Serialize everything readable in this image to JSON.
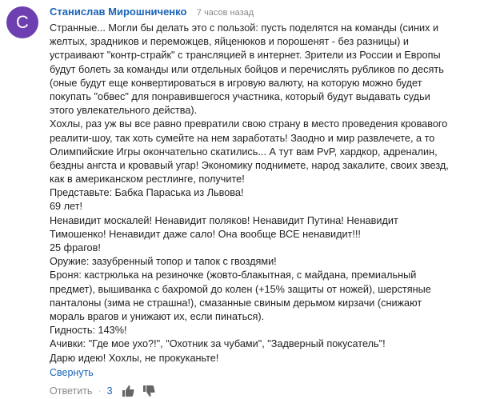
{
  "comment": {
    "avatar_letter": "C",
    "avatar_color": "#6d3fb0",
    "author": "Станислав Мирошниченко",
    "time": "7 часов назад",
    "lines": [
      "Странные... Могли бы делать это с пользой: пусть поделятся на команды (синих и",
      "желтых, зрадников и переможцев, яйценюков и порошенят - без разницы) и",
      "устраивают \"контр-страйк\" с трансляцией в интернет. Зрители из России и Европы",
      "будут болеть за команды или отдельных бойцов и перечислять рубликов по десять",
      "(оные будут еще конвертироваться в игровую валюту, на которую можно будет",
      "покупать \"обвес\" для понравившегося участника, который будут выдавать судьи",
      "этого увлекательного действа).",
      "Хохлы, раз уж вы все равно превратили свою страну в место проведения кровавого",
      "реалити-шоу, так хоть сумейте на нем заработать! Заодно и мир развлечете, а то",
      "Олимпийские Игры окончательно скатились... А тут вам PvP, хардкор, адреналин,",
      "бездны ангста и кровавый угар! Экономику поднимете, народ закалите, своих звезд,",
      "как в американском рестлинге, получите!",
      "Представьте: Бабка Параська из Львова!",
      "69 лет!",
      "Ненавидит москалей! Ненавидит поляков! Ненавидит Путина! Ненавидит",
      "Тимошенко! Ненавидит даже сало! Она вообще ВСЕ ненавидит!!!",
      "25 фрагов!",
      "Оружие: зазубренный топор и тапок с гвоздями!",
      "Броня: кастрюлька на резиночке (жовто-блакытная, с майдана, премиальный",
      "предмет), вышиванка с бахромой до колен (+15% защиты от ножей), шерстяные",
      "панталоны (зима не страшна!), смазанные свиным дерьмом кирзачи (снижают",
      "мораль врагов и унижают их, если пинаться).",
      "Гидность: 143%!",
      "Ачивки: \"Где мое ухо?!\", \"Охотник за чубами\", \"Задверный покусатель\"!",
      "Дарю идею! Хохлы, не прокуканьте!"
    ],
    "collapse_label": "Свернуть",
    "reply_label": "Ответить",
    "separator": "·",
    "likes": "3",
    "link_color": "#1a63b8"
  }
}
